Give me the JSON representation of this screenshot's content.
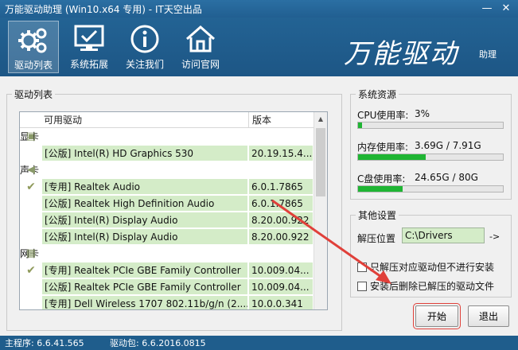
{
  "window": {
    "title": "万能驱动助理 (Win10.x64 专用) - IT天空出品",
    "controls": {
      "minimize": "—",
      "close": "✕"
    }
  },
  "toolbar": {
    "buttons": [
      {
        "label": "驱动列表",
        "icon": "gears-icon",
        "active": true
      },
      {
        "label": "系统拓展",
        "icon": "monitor-check-icon",
        "active": false
      },
      {
        "label": "关注我们",
        "icon": "info-icon",
        "active": false
      },
      {
        "label": "访问官网",
        "icon": "home-icon",
        "active": false
      }
    ],
    "brand": "万能驱动",
    "brand_sub": "助理"
  },
  "driver_list": {
    "group_title": "驱动列表",
    "columns": [
      "可用驱动",
      "版本"
    ],
    "rows": [
      {
        "kind": "category",
        "name": "显卡",
        "icon": "display-icon"
      },
      {
        "kind": "item",
        "name": "[公版] Intel(R) HD Graphics 530",
        "version": "20.19.15.4...",
        "checked": false
      },
      {
        "kind": "category",
        "name": "声卡",
        "icon": "speaker-icon"
      },
      {
        "kind": "item",
        "name": "[专用] Realtek Audio",
        "version": "6.0.1.7865",
        "checked": true
      },
      {
        "kind": "item",
        "name": "[公版] Realtek High Definition Audio",
        "version": "6.0.1.7865",
        "checked": false
      },
      {
        "kind": "item",
        "name": "[公版] Intel(R) Display Audio",
        "version": "8.20.00.922",
        "checked": false
      },
      {
        "kind": "item",
        "name": "[公版] Intel(R) Display Audio",
        "version": "8.20.00.922",
        "checked": false
      },
      {
        "kind": "category",
        "name": "网卡",
        "icon": "network-icon"
      },
      {
        "kind": "item",
        "name": "[专用] Realtek PCIe GBE Family Controller",
        "version": "10.009.04...",
        "checked": true
      },
      {
        "kind": "item",
        "name": "[公版] Realtek PCIe GBE Family Controller",
        "version": "10.009.04...",
        "checked": false
      },
      {
        "kind": "item",
        "name": "[专用] Dell Wireless 1707 802.11b/g/n (2....",
        "version": "10.0.0.341",
        "checked": false
      }
    ]
  },
  "resources": {
    "group_title": "系统资源",
    "items": [
      {
        "label": "CPU使用率:",
        "value": "3%",
        "fraction": 0.03
      },
      {
        "label": "内存使用率:",
        "value": "3.69G / 7.91G",
        "fraction": 0.466
      },
      {
        "label": "C盘使用率:",
        "value": "24.65G / 80G",
        "fraction": 0.308
      }
    ]
  },
  "settings": {
    "group_title": "其他设置",
    "path_label": "解压位置",
    "path_value": "C:\\Drivers",
    "browse": "->",
    "options": [
      {
        "label": "只解压对应驱动但不进行安装",
        "checked": false
      },
      {
        "label": "安装后删除已解压的驱动文件",
        "checked": false
      }
    ]
  },
  "buttons": {
    "start": "开始",
    "exit": "退出"
  },
  "status": {
    "main_version": "主程序: 6.6.41.565",
    "pack_version": "驱动包: 6.6.2016.0815"
  },
  "colors": {
    "accent": "#1f5d8c",
    "row_fill": "#d4ecc8",
    "bar_fill": "#1fb533",
    "annotation": "#e0403a"
  }
}
